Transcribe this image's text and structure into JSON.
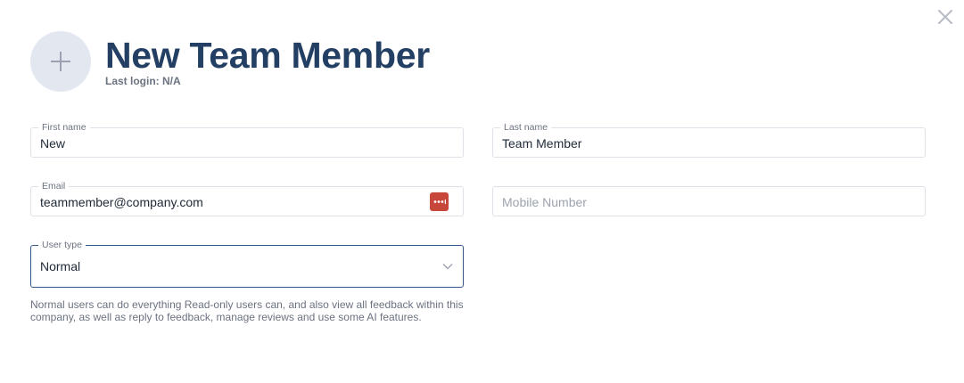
{
  "header": {
    "title": "New Team Member",
    "last_login": "Last login: N/A"
  },
  "icons": {
    "close": "close-icon",
    "avatar_add": "plus-icon",
    "password_manager": "password-manager-icon",
    "dropdown": "chevron-down-icon"
  },
  "colors": {
    "title": "#233f63",
    "focus_border": "#35588a",
    "password_icon": "#c8473b",
    "avatar_bg": "#e3e7f0"
  },
  "form": {
    "first_name": {
      "label": "First name",
      "value": "New"
    },
    "last_name": {
      "label": "Last name",
      "value": "Team Member"
    },
    "email": {
      "label": "Email",
      "value": "teammember@company.com"
    },
    "mobile": {
      "placeholder": "Mobile Number",
      "value": ""
    },
    "user_type": {
      "label": "User type",
      "value": "Normal",
      "help": "Normal users can do everything Read-only users can, and also view all feedback within this company, as well as reply to feedback, manage reviews and use some AI features."
    }
  }
}
